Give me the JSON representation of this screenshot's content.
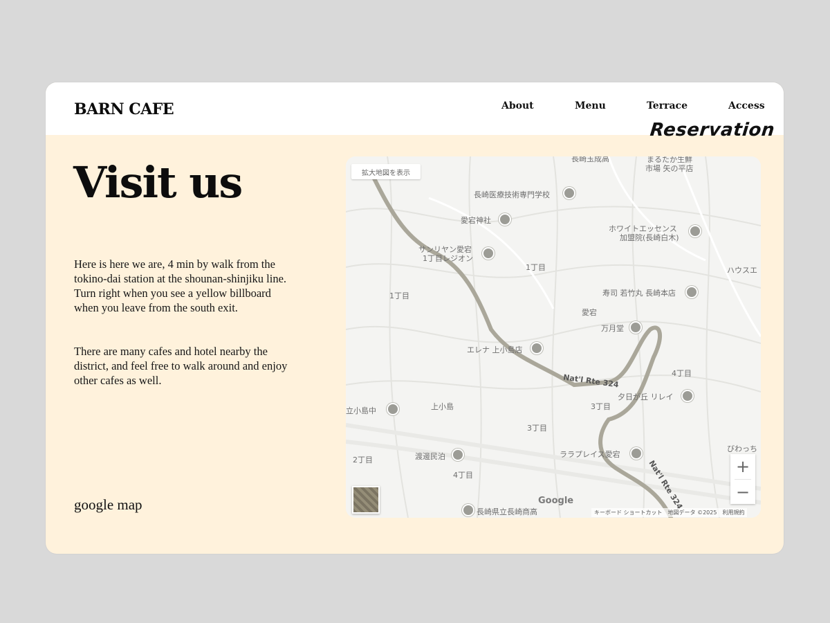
{
  "brand": "BARN CAFE",
  "nav": {
    "about": "About",
    "menu": "Menu",
    "terrace": "Terrace",
    "access": "Access",
    "reservation": "Reservation"
  },
  "page": {
    "title": "Visit us",
    "paragraph1": "Here is here we are, 4 min by walk from the tokino-dai station at the shounan-shinjiku line. Turn right when you see a yellow billboard when you leave from the south exit.",
    "paragraph2": "There are many cafes and hotel nearby the district, and feel free to walk around and enjoy other cafes as well.",
    "map_caption": "google map"
  },
  "map": {
    "expand_label": "拡大地図を表示",
    "zoom_in": "+",
    "zoom_out": "−",
    "google_logo": "Google",
    "attribution": "キーボード ショートカット　地図データ ©2025　利用規約",
    "labels": [
      "長崎医療技術専門学校",
      "愛宕神社",
      "ホワイトエッセンス",
      "加盟院(長崎白木)",
      "サンリヤン愛宕",
      "1丁目レジオン",
      "1丁目",
      "1丁目",
      "寿司 若竹丸 長崎本店",
      "愛宕",
      "万月堂",
      "エレナ 上小島店",
      "Nat'l Rte 324",
      "4丁目",
      "夕日が丘 リレイ",
      "上小島",
      "3丁目",
      "3丁目",
      "渡邊民泊",
      "ララプレイス愛宕",
      "4丁目",
      "2丁目",
      "長崎県立長崎商高",
      "立小島中",
      "まるたか生鮮",
      "市場 矢の平店",
      "長崎玉成高",
      "ハウスエ",
      "びわっち",
      "Nat'l Rte 324"
    ]
  },
  "colors": {
    "page_bg": "#d9d9d9",
    "card_bg": "#fff2dc",
    "header_bg": "#ffffff",
    "text": "#111111",
    "road": "#aaa79a"
  }
}
